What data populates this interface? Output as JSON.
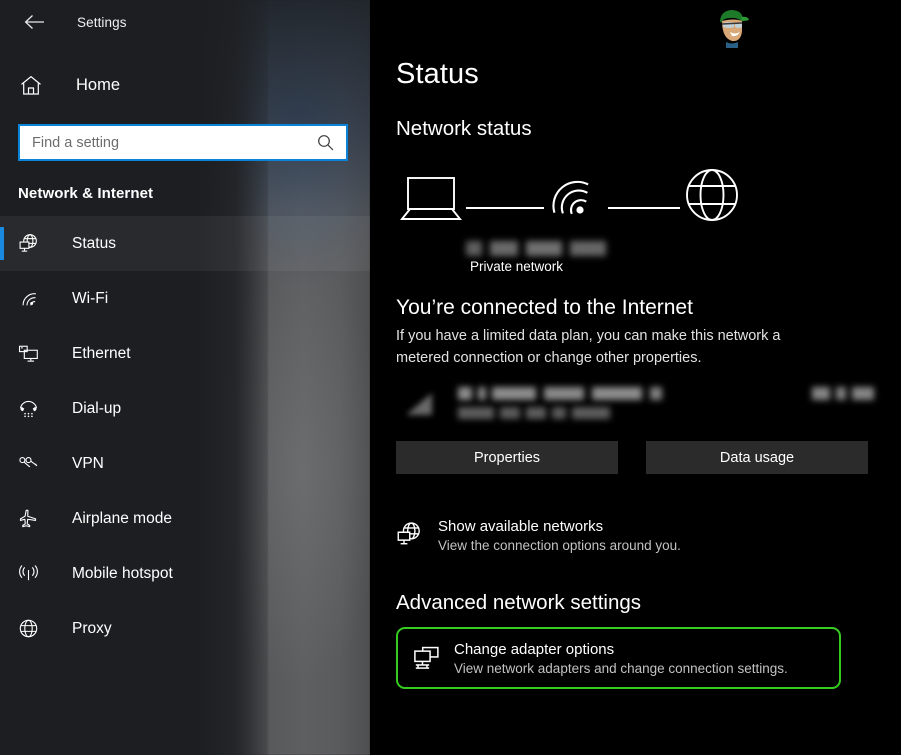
{
  "window": {
    "title": "Settings",
    "back_icon": "back-arrow-icon"
  },
  "sidebar": {
    "home": {
      "label": "Home",
      "icon": "home-icon"
    },
    "search": {
      "placeholder": "Find a setting",
      "value": "",
      "icon": "search-icon"
    },
    "section_title": "Network & Internet",
    "accent_color": "#1a8ae0",
    "items": [
      {
        "label": "Status",
        "icon": "network-status-icon",
        "selected": true
      },
      {
        "label": "Wi-Fi",
        "icon": "wifi-icon",
        "selected": false
      },
      {
        "label": "Ethernet",
        "icon": "ethernet-icon",
        "selected": false
      },
      {
        "label": "Dial-up",
        "icon": "dialup-phone-icon",
        "selected": false
      },
      {
        "label": "VPN",
        "icon": "vpn-icon",
        "selected": false
      },
      {
        "label": "Airplane mode",
        "icon": "airplane-icon",
        "selected": false
      },
      {
        "label": "Mobile hotspot",
        "icon": "hotspot-icon",
        "selected": false
      },
      {
        "label": "Proxy",
        "icon": "globe-icon",
        "selected": false
      }
    ]
  },
  "main": {
    "page_title": "Status",
    "network_status_heading": "Network status",
    "diagram": {
      "device_icon": "laptop-icon",
      "connection_icon": "wifi-icon",
      "internet_icon": "globe-icon",
      "network_name": "",
      "network_type": "Private network"
    },
    "connected_heading": "You’re connected to the Internet",
    "connected_description": "If you have a limited data plan, you can make this network a metered connection or change other properties.",
    "usage_row": {
      "icon": "wifi-signal-icon",
      "network_name": "",
      "period": "",
      "amount": ""
    },
    "buttons": [
      {
        "label": "Properties"
      },
      {
        "label": "Data usage"
      }
    ],
    "show_networks": {
      "icon": "network-status-icon",
      "title": "Show available networks",
      "subtitle": "View the connection options around you."
    },
    "advanced_heading": "Advanced network settings",
    "adapter_options": {
      "icon": "adapter-monitors-icon",
      "title": "Change adapter options",
      "subtitle": "View network adapters and change connection settings.",
      "highlight_color": "#36cc1f"
    },
    "watermark": {
      "icon": "mascot-avatar-icon"
    }
  }
}
